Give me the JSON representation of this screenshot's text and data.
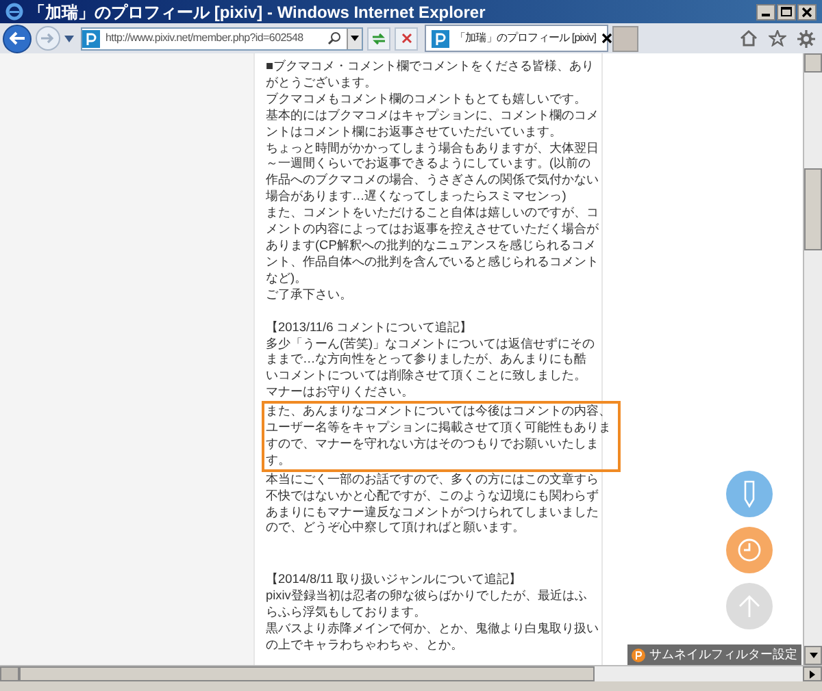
{
  "window": {
    "title": "「加瑞」のプロフィール [pixiv] - Windows Internet Explorer"
  },
  "address_bar": {
    "url": "http://www.pixiv.net/member.php?id=602548"
  },
  "tabs": [
    {
      "label": "「加瑞」のプロフィール [pixiv]",
      "selected": true
    }
  ],
  "content": [
    {
      "kind": "text",
      "text": "■ブクマコメ・コメント欄でコメントをくださる皆様、ありがとうございます。"
    },
    {
      "kind": "text",
      "text": "ブクマコメもコメント欄のコメントもとても嬉しいです。"
    },
    {
      "kind": "text",
      "text": "基本的にはブクマコメはキャプションに、コメント欄のコメントはコメント欄にお返事させていただいています。"
    },
    {
      "kind": "text",
      "text": "ちょっと時間がかかってしまう場合もありますが、大体翌日～一週間くらいでお返事できるようにしています。(以前の作品へのブクマコメの場合、うさぎさんの関係で気付かない場合があります…遅くなってしまったらスミマセンっ)"
    },
    {
      "kind": "text",
      "text": "また、コメントをいただけること自体は嬉しいのですが、コメントの内容によってはお返事を控えさせていただく場合があります(CP解釈への批判的なニュアンスを感じられるコメント、作品自体への批判を含んでいると感じられるコメントなど)。"
    },
    {
      "kind": "text",
      "text": "ご了承下さい。"
    },
    {
      "kind": "heading",
      "text": "【2013/11/6 コメントについて追記】"
    },
    {
      "kind": "text",
      "text": "多少「うーん(苦笑)」なコメントについては返信せずにそのままで…な方向性をとって参りましたが、あんまりにも酷いコメントについては削除させて頂くことに致しました。"
    },
    {
      "kind": "text",
      "text": "マナーはお守りください。"
    },
    {
      "kind": "boxed",
      "text": "また、あんまりなコメントについては今後はコメントの内容、ユーザー名等をキャプションに掲載させて頂く可能性もありますので、マナーを守れない方はそのつもりでお願いいたします。"
    },
    {
      "kind": "text",
      "text": "本当にごく一部のお話ですので、多くの方にはこの文章すら不快ではないかと心配ですが、このような辺境にも関わらずあまりにもマナー違反なコメントがつけられてしまいましたので、どうぞ心中察して頂ければと願います。"
    },
    {
      "kind": "heading2",
      "text": "【2014/8/11 取り扱いジャンルについて追記】"
    },
    {
      "kind": "text",
      "text": "pixiv登録当初は忍者の卵な彼らばかりでしたが、最近はふらふら浮気もしております。"
    },
    {
      "kind": "text",
      "text": "黒バスより赤降メインで何か、とか、鬼徹より白鬼取り扱いの上でキャラわちゃわちゃ、とか。"
    }
  ],
  "filter_button": {
    "label": "サムネイルフィルター設定"
  }
}
